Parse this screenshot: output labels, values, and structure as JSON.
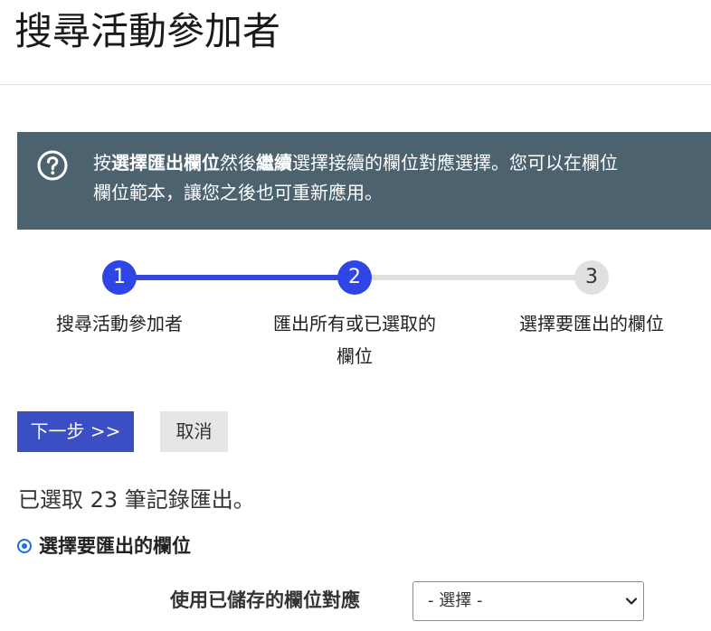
{
  "page": {
    "title": "搜尋活動參加者"
  },
  "help": {
    "line1_prefix": "按",
    "line1_bold1": "選擇匯出欄位",
    "line1_mid": "然後",
    "line1_bold2": "繼續",
    "line1_suffix": "選擇接續的欄位對應選擇。您可以在欄位",
    "line2": "欄位範本，讓您之後也可重新應用。",
    "icon": "question-circle-icon"
  },
  "stepper": {
    "steps": [
      {
        "number": "1",
        "label": "搜尋活動參加者",
        "state": "complete"
      },
      {
        "number": "2",
        "label_line1": "匯出所有或已選取的",
        "label_line2": "欄位",
        "state": "active"
      },
      {
        "number": "3",
        "label": "選擇要匯出的欄位",
        "state": "pending"
      }
    ],
    "colors": {
      "active": "#2f46e6",
      "pending": "#e0e0e0"
    }
  },
  "actions": {
    "next_label": "下一步 >>",
    "cancel_label": "取消"
  },
  "summary": {
    "selected_text": "已選取 23 筆記錄匯出。"
  },
  "export_option": {
    "label": "選擇要匯出的欄位",
    "selected": true
  },
  "saved_mapping": {
    "label": "使用已儲存的欄位對應",
    "selected_value": "- 選擇 -"
  },
  "colors": {
    "banner_bg": "#4d626f",
    "primary_button": "#3a4fc4",
    "secondary_button": "#e6e6e6"
  }
}
